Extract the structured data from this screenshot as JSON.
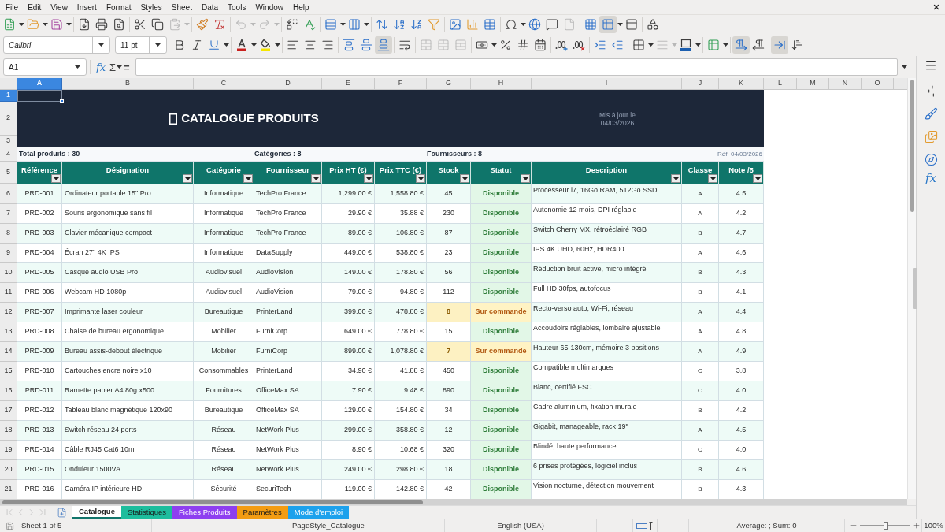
{
  "menu": [
    "File",
    "Edit",
    "View",
    "Insert",
    "Format",
    "Styles",
    "Sheet",
    "Data",
    "Tools",
    "Window",
    "Help"
  ],
  "toolbar1": [
    {
      "kind": "button",
      "dropdown": true,
      "disabled": false,
      "pressed": false
    },
    {
      "kind": "button",
      "dropdown": true,
      "disabled": false,
      "pressed": false
    },
    {
      "kind": "button",
      "dropdown": true,
      "disabled": false,
      "pressed": false
    },
    {
      "kind": "separator"
    },
    {
      "kind": "button",
      "dropdown": false,
      "disabled": false,
      "pressed": false
    },
    {
      "kind": "button",
      "dropdown": false,
      "disabled": false,
      "pressed": false
    },
    {
      "kind": "button",
      "dropdown": false,
      "disabled": false,
      "pressed": false
    },
    {
      "kind": "separator"
    },
    {
      "kind": "button",
      "dropdown": false,
      "disabled": false,
      "pressed": false
    },
    {
      "kind": "button",
      "dropdown": false,
      "disabled": false,
      "pressed": false
    },
    {
      "kind": "button",
      "dropdown": true,
      "disabled": true,
      "pressed": false
    },
    {
      "kind": "separator"
    },
    {
      "kind": "button",
      "dropdown": false,
      "disabled": false,
      "pressed": false
    },
    {
      "kind": "button",
      "dropdown": false,
      "disabled": false,
      "pressed": false
    },
    {
      "kind": "separator"
    },
    {
      "kind": "button",
      "dropdown": true,
      "disabled": true,
      "pressed": false
    },
    {
      "kind": "button",
      "dropdown": true,
      "disabled": true,
      "pressed": false
    },
    {
      "kind": "separator"
    },
    {
      "kind": "button",
      "dropdown": false,
      "disabled": false,
      "pressed": false
    },
    {
      "kind": "button",
      "dropdown": false,
      "disabled": false,
      "pressed": false
    },
    {
      "kind": "separator"
    },
    {
      "kind": "button",
      "dropdown": true,
      "disabled": false,
      "pressed": false
    },
    {
      "kind": "button",
      "dropdown": true,
      "disabled": false,
      "pressed": false
    },
    {
      "kind": "separator"
    },
    {
      "kind": "button",
      "dropdown": false,
      "disabled": false,
      "pressed": false
    },
    {
      "kind": "button",
      "dropdown": false,
      "disabled": false,
      "pressed": false
    },
    {
      "kind": "button",
      "dropdown": false,
      "disabled": false,
      "pressed": false
    },
    {
      "kind": "button",
      "dropdown": false,
      "disabled": false,
      "pressed": false
    },
    {
      "kind": "separator"
    },
    {
      "kind": "button",
      "dropdown": false,
      "disabled": false,
      "pressed": false
    },
    {
      "kind": "button",
      "dropdown": false,
      "disabled": false,
      "pressed": false
    },
    {
      "kind": "button",
      "dropdown": false,
      "disabled": false,
      "pressed": false
    },
    {
      "kind": "separator"
    },
    {
      "kind": "button",
      "dropdown": true,
      "disabled": false,
      "pressed": false
    },
    {
      "kind": "button",
      "dropdown": false,
      "disabled": false,
      "pressed": false
    },
    {
      "kind": "button",
      "dropdown": false,
      "disabled": false,
      "pressed": false
    },
    {
      "kind": "button",
      "dropdown": false,
      "disabled": true,
      "pressed": false
    },
    {
      "kind": "separator"
    },
    {
      "kind": "button",
      "dropdown": false,
      "disabled": false,
      "pressed": false
    },
    {
      "kind": "button",
      "dropdown": true,
      "disabled": false,
      "pressed": true
    },
    {
      "kind": "button",
      "dropdown": false,
      "disabled": false,
      "pressed": false
    },
    {
      "kind": "separator"
    },
    {
      "kind": "button",
      "dropdown": false,
      "disabled": false,
      "pressed": false
    }
  ],
  "toolbar2": [
    {
      "kind": "combo",
      "value": "Calibri"
    },
    {
      "kind": "combo",
      "value": "11 pt"
    },
    {
      "kind": "separator"
    },
    {
      "kind": "button",
      "dropdown": false,
      "disabled": false,
      "pressed": false
    },
    {
      "kind": "button",
      "dropdown": false,
      "disabled": false,
      "pressed": false
    },
    {
      "kind": "button",
      "dropdown": true,
      "disabled": false,
      "pressed": false
    },
    {
      "kind": "separator"
    },
    {
      "kind": "button",
      "dropdown": true,
      "disabled": false,
      "pressed": false
    },
    {
      "kind": "button",
      "dropdown": true,
      "disabled": false,
      "pressed": false
    },
    {
      "kind": "separator"
    },
    {
      "kind": "button",
      "dropdown": false,
      "disabled": false,
      "pressed": false
    },
    {
      "kind": "button",
      "dropdown": false,
      "disabled": false,
      "pressed": false
    },
    {
      "kind": "button",
      "dropdown": false,
      "disabled": false,
      "pressed": false
    },
    {
      "kind": "separator"
    },
    {
      "kind": "button",
      "dropdown": false,
      "disabled": false,
      "pressed": false
    },
    {
      "kind": "button",
      "dropdown": false,
      "disabled": false,
      "pressed": false
    },
    {
      "kind": "button",
      "dropdown": false,
      "disabled": false,
      "pressed": true
    },
    {
      "kind": "separator"
    },
    {
      "kind": "button",
      "dropdown": false,
      "disabled": false,
      "pressed": false
    },
    {
      "kind": "separator"
    },
    {
      "kind": "button",
      "dropdown": false,
      "disabled": true,
      "pressed": false
    },
    {
      "kind": "button",
      "dropdown": false,
      "disabled": true,
      "pressed": false
    },
    {
      "kind": "button",
      "dropdown": false,
      "disabled": true,
      "pressed": false
    },
    {
      "kind": "separator"
    },
    {
      "kind": "button",
      "dropdown": true,
      "disabled": false,
      "pressed": false
    },
    {
      "kind": "button",
      "dropdown": false,
      "disabled": false,
      "pressed": false
    },
    {
      "kind": "button",
      "dropdown": false,
      "disabled": false,
      "pressed": false
    },
    {
      "kind": "button",
      "dropdown": false,
      "disabled": false,
      "pressed": false
    },
    {
      "kind": "separator"
    },
    {
      "kind": "button",
      "dropdown": false,
      "disabled": false,
      "pressed": false
    },
    {
      "kind": "button",
      "dropdown": false,
      "disabled": false,
      "pressed": false
    },
    {
      "kind": "separator"
    },
    {
      "kind": "button",
      "dropdown": false,
      "disabled": false,
      "pressed": false
    },
    {
      "kind": "button",
      "dropdown": false,
      "disabled": false,
      "pressed": false
    },
    {
      "kind": "separator"
    },
    {
      "kind": "button",
      "dropdown": true,
      "disabled": false,
      "pressed": false
    },
    {
      "kind": "button",
      "dropdown": true,
      "disabled": true,
      "pressed": false
    },
    {
      "kind": "button",
      "dropdown": true,
      "disabled": false,
      "pressed": false
    },
    {
      "kind": "separator"
    },
    {
      "kind": "button",
      "dropdown": true,
      "disabled": false,
      "pressed": false
    },
    {
      "kind": "separator"
    },
    {
      "kind": "button",
      "dropdown": false,
      "disabled": false,
      "pressed": true
    },
    {
      "kind": "button",
      "dropdown": false,
      "disabled": false,
      "pressed": false
    },
    {
      "kind": "separator"
    },
    {
      "kind": "button",
      "dropdown": false,
      "disabled": false,
      "pressed": true
    },
    {
      "kind": "button",
      "dropdown": false,
      "disabled": false,
      "pressed": false
    }
  ],
  "formula_bar": {
    "name_box": "A1",
    "function_wizard": "fx",
    "sum": "Σ",
    "equals": "="
  },
  "sheet": {
    "columns": [
      {
        "label": "A",
        "selected": true
      },
      {
        "label": "B",
        "selected": false
      },
      {
        "label": "C",
        "selected": false
      },
      {
        "label": "D",
        "selected": false
      },
      {
        "label": "E",
        "selected": false
      },
      {
        "label": "F",
        "selected": false
      },
      {
        "label": "G",
        "selected": false
      },
      {
        "label": "H",
        "selected": false
      },
      {
        "label": "I",
        "selected": false
      },
      {
        "label": "J",
        "selected": false
      },
      {
        "label": "K",
        "selected": false
      },
      {
        "label": "L",
        "selected": false
      },
      {
        "label": "M",
        "selected": false
      },
      {
        "label": "N",
        "selected": false
      },
      {
        "label": "O",
        "selected": false
      }
    ],
    "row_headers": [
      {
        "label": "1",
        "selected": true
      },
      {
        "label": "2",
        "selected": false
      },
      {
        "label": "3",
        "selected": false
      },
      {
        "label": "4",
        "selected": false
      },
      {
        "label": "5",
        "selected": false
      },
      {
        "label": "6",
        "selected": false
      },
      {
        "label": "7",
        "selected": false
      },
      {
        "label": "8",
        "selected": false
      },
      {
        "label": "9",
        "selected": false
      },
      {
        "label": "10",
        "selected": false
      },
      {
        "label": "11",
        "selected": false
      },
      {
        "label": "12",
        "selected": false
      },
      {
        "label": "13",
        "selected": false
      },
      {
        "label": "14",
        "selected": false
      },
      {
        "label": "15",
        "selected": false
      },
      {
        "label": "16",
        "selected": false
      },
      {
        "label": "17",
        "selected": false
      },
      {
        "label": "18",
        "selected": false
      },
      {
        "label": "19",
        "selected": false
      },
      {
        "label": "20",
        "selected": false
      },
      {
        "label": "21",
        "selected": false
      }
    ],
    "title": "CATALOGUE PRODUITS",
    "updated": [
      "Mis à jour le",
      "04/03/2026"
    ],
    "summary": {
      "products": "Total produits : 30",
      "categories": "Catégories : 8",
      "suppliers": "Fournisseurs : 8",
      "reference": "Réf. 04/03/2026"
    },
    "headers": [
      "Référence",
      "Désignation",
      "Catégorie",
      "Fournisseur",
      "Prix HT (€)",
      "Prix TTC (€)",
      "Stock",
      "Statut",
      "Description",
      "Classe",
      "Note /5"
    ],
    "rows": [
      {
        "ref": "PRD-001",
        "name": "Ordinateur portable 15\" Pro",
        "category": "Informatique",
        "supplier": "TechPro France",
        "price_ht": "1,299.00 €",
        "price_ttc": "1,558.80 €",
        "stock": "45",
        "stock_low": false,
        "status": {
          "label": "Disponible",
          "kind": "available"
        },
        "description": "Processeur i7, 16Go RAM, 512Go SSD",
        "class": "A",
        "rating": "4.5"
      },
      {
        "ref": "PRD-002",
        "name": "Souris ergonomique sans fil",
        "category": "Informatique",
        "supplier": "TechPro France",
        "price_ht": "29.90 €",
        "price_ttc": "35.88 €",
        "stock": "230",
        "stock_low": false,
        "status": {
          "label": "Disponible",
          "kind": "available"
        },
        "description": "Autonomie 12 mois, DPI réglable",
        "class": "A",
        "rating": "4.2"
      },
      {
        "ref": "PRD-003",
        "name": "Clavier mécanique compact",
        "category": "Informatique",
        "supplier": "TechPro France",
        "price_ht": "89.00 €",
        "price_ttc": "106.80 €",
        "stock": "87",
        "stock_low": false,
        "status": {
          "label": "Disponible",
          "kind": "available"
        },
        "description": "Switch Cherry MX, rétroéclairé RGB",
        "class": "B",
        "rating": "4.7"
      },
      {
        "ref": "PRD-004",
        "name": "Écran 27\" 4K IPS",
        "category": "Informatique",
        "supplier": "DataSupply",
        "price_ht": "449.00 €",
        "price_ttc": "538.80 €",
        "stock": "23",
        "stock_low": false,
        "status": {
          "label": "Disponible",
          "kind": "available"
        },
        "description": "IPS 4K UHD, 60Hz, HDR400",
        "class": "A",
        "rating": "4.6"
      },
      {
        "ref": "PRD-005",
        "name": "Casque audio USB Pro",
        "category": "Audiovisuel",
        "supplier": "AudioVision",
        "price_ht": "149.00 €",
        "price_ttc": "178.80 €",
        "stock": "56",
        "stock_low": false,
        "status": {
          "label": "Disponible",
          "kind": "available"
        },
        "description": "Réduction bruit active, micro intégré",
        "class": "B",
        "rating": "4.3"
      },
      {
        "ref": "PRD-006",
        "name": "Webcam HD 1080p",
        "category": "Audiovisuel",
        "supplier": "AudioVision",
        "price_ht": "79.00 €",
        "price_ttc": "94.80 €",
        "stock": "112",
        "stock_low": false,
        "status": {
          "label": "Disponible",
          "kind": "available"
        },
        "description": "Full HD 30fps, autofocus",
        "class": "B",
        "rating": "4.1"
      },
      {
        "ref": "PRD-007",
        "name": "Imprimante laser couleur",
        "category": "Bureautique",
        "supplier": "PrinterLand",
        "price_ht": "399.00 €",
        "price_ttc": "478.80 €",
        "stock": "8",
        "stock_low": true,
        "status": {
          "label": "Sur commande",
          "kind": "on_order"
        },
        "description": "Recto-verso auto, Wi-Fi, réseau",
        "class": "A",
        "rating": "4.4"
      },
      {
        "ref": "PRD-008",
        "name": "Chaise de bureau ergonomique",
        "category": "Mobilier",
        "supplier": "FurniCorp",
        "price_ht": "649.00 €",
        "price_ttc": "778.80 €",
        "stock": "15",
        "stock_low": false,
        "status": {
          "label": "Disponible",
          "kind": "available"
        },
        "description": "Accoudoirs réglables, lombaire ajustable",
        "class": "A",
        "rating": "4.8"
      },
      {
        "ref": "PRD-009",
        "name": "Bureau assis-debout électrique",
        "category": "Mobilier",
        "supplier": "FurniCorp",
        "price_ht": "899.00 €",
        "price_ttc": "1,078.80 €",
        "stock": "7",
        "stock_low": true,
        "status": {
          "label": "Sur commande",
          "kind": "on_order"
        },
        "description": "Hauteur 65-130cm, mémoire 3 positions",
        "class": "A",
        "rating": "4.9"
      },
      {
        "ref": "PRD-010",
        "name": "Cartouches encre noire x10",
        "category": "Consommables",
        "supplier": "PrinterLand",
        "price_ht": "34.90 €",
        "price_ttc": "41.88 €",
        "stock": "450",
        "stock_low": false,
        "status": {
          "label": "Disponible",
          "kind": "available"
        },
        "description": "Compatible multimarques",
        "class": "C",
        "rating": "3.8"
      },
      {
        "ref": "PRD-011",
        "name": "Ramette papier A4 80g x500",
        "category": "Fournitures",
        "supplier": "OfficeMax SA",
        "price_ht": "7.90 €",
        "price_ttc": "9.48 €",
        "stock": "890",
        "stock_low": false,
        "status": {
          "label": "Disponible",
          "kind": "available"
        },
        "description": "Blanc, certifié FSC",
        "class": "C",
        "rating": "4.0"
      },
      {
        "ref": "PRD-012",
        "name": "Tableau blanc magnétique 120x90",
        "category": "Bureautique",
        "supplier": "OfficeMax SA",
        "price_ht": "129.00 €",
        "price_ttc": "154.80 €",
        "stock": "34",
        "stock_low": false,
        "status": {
          "label": "Disponible",
          "kind": "available"
        },
        "description": "Cadre aluminium, fixation murale",
        "class": "B",
        "rating": "4.2"
      },
      {
        "ref": "PRD-013",
        "name": "Switch réseau 24 ports",
        "category": "Réseau",
        "supplier": "NetWork Plus",
        "price_ht": "299.00 €",
        "price_ttc": "358.80 €",
        "stock": "12",
        "stock_low": false,
        "status": {
          "label": "Disponible",
          "kind": "available"
        },
        "description": "Gigabit, manageable, rack 19\"",
        "class": "A",
        "rating": "4.5"
      },
      {
        "ref": "PRD-014",
        "name": "Câble RJ45 Cat6 10m",
        "category": "Réseau",
        "supplier": "NetWork Plus",
        "price_ht": "8.90 €",
        "price_ttc": "10.68 €",
        "stock": "320",
        "stock_low": false,
        "status": {
          "label": "Disponible",
          "kind": "available"
        },
        "description": "Blindé, haute performance",
        "class": "C",
        "rating": "4.0"
      },
      {
        "ref": "PRD-015",
        "name": "Onduleur 1500VA",
        "category": "Réseau",
        "supplier": "NetWork Plus",
        "price_ht": "249.00 €",
        "price_ttc": "298.80 €",
        "stock": "18",
        "stock_low": false,
        "status": {
          "label": "Disponible",
          "kind": "available"
        },
        "description": "6 prises protégées, logiciel inclus",
        "class": "B",
        "rating": "4.6"
      },
      {
        "ref": "PRD-016",
        "name": "Caméra IP intérieure HD",
        "category": "Sécurité",
        "supplier": "SecuriTech",
        "price_ht": "119.00 €",
        "price_ttc": "142.80 €",
        "stock": "42",
        "stock_low": false,
        "status": {
          "label": "Disponible",
          "kind": "available"
        },
        "description": "Vision nocturne, détection mouvement",
        "class": "B",
        "rating": "4.3"
      }
    ]
  },
  "sheet_nav": [
    {
      "disabled": true
    },
    {
      "disabled": true
    },
    {
      "disabled": true
    },
    {
      "disabled": true
    }
  ],
  "sheet_tabs": [
    {
      "label": "Catalogue",
      "selected": true,
      "color": "#11756b"
    },
    {
      "label": "Statistiques",
      "selected": false,
      "color": "#1dbd9d"
    },
    {
      "label": "Fiches Produits",
      "selected": false,
      "color": "#8e3ff0"
    },
    {
      "label": "Paramètres",
      "selected": false,
      "color": "#f39c12"
    },
    {
      "label": "Mode d'emploi",
      "selected": false,
      "color": "#1da1ec"
    }
  ],
  "sidebar": {
    "functions": "fx"
  },
  "status_bar": {
    "sheet": "Sheet 1 of 5",
    "page_style": "PageStyle_Catalogue",
    "language": "English (USA)",
    "selection": "Average: ; Sum: 0",
    "zoom": {
      "level": 0.5,
      "reading": "100%"
    }
  }
}
